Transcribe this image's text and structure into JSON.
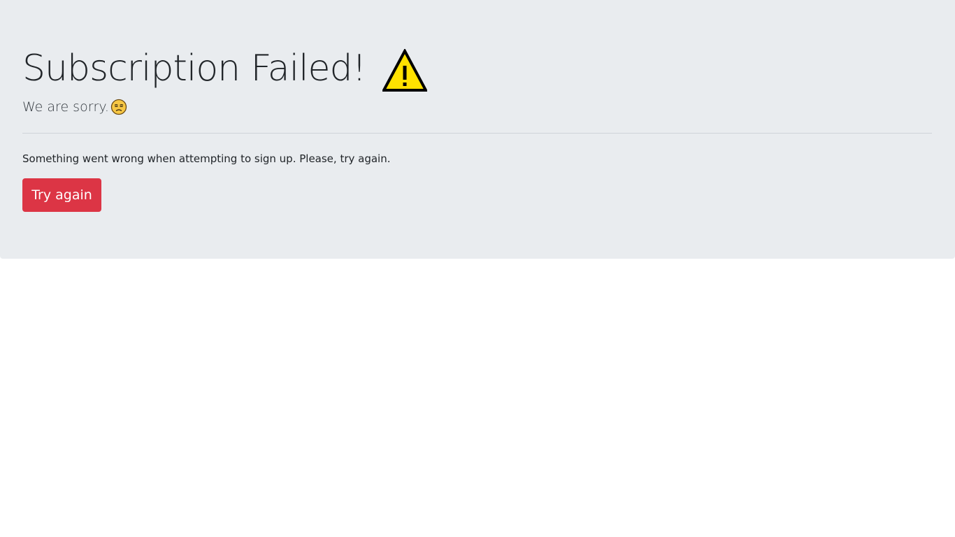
{
  "header": {
    "title": "Subscription Failed!",
    "subtitle": "We are sorry."
  },
  "icons": {
    "title_icon": "warning-icon",
    "subtitle_icon": "sad-face-icon"
  },
  "body": {
    "message": "Something went wrong when attempting to sign up. Please, try again."
  },
  "actions": {
    "retry_label": "Try again"
  },
  "colors": {
    "jumbotron_background": "#e9ecef",
    "button_danger": "#dc3545",
    "warning_yellow": "#ffe100",
    "text": "#212529"
  }
}
